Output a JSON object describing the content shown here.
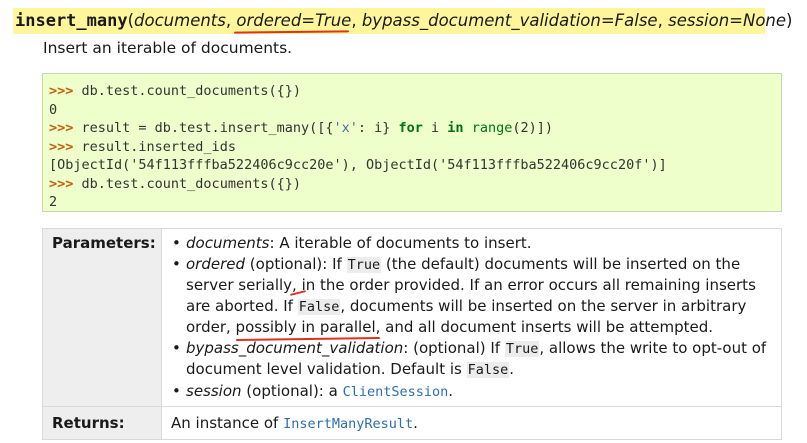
{
  "signature": {
    "function_name": "insert_many",
    "open_paren": "(",
    "close_paren": ")",
    "sep": ", ",
    "params": [
      "documents",
      "ordered=True",
      "bypass_document_validation=False",
      "session=None"
    ]
  },
  "description": "Insert an iterable of documents.",
  "example": {
    "prompt": ">>>",
    "lines": {
      "l1_code": " db.test.count_documents({})",
      "l2_out": "0",
      "l3_pre": " result = db.test.insert_many([{",
      "l3_str": "'x'",
      "l3_mid": ": i} ",
      "l3_kw1": "for",
      "l3_mid2": " i ",
      "l3_kw2": "in",
      "l3_sp": " ",
      "l3_builtin": "range",
      "l3_end": "(2)])",
      "l4_code": " result.inserted_ids",
      "l5_out": "[ObjectId('54f113fffba522406c9cc20e'), ObjectId('54f113fffba522406c9cc20f')]",
      "l6_code": " db.test.count_documents({})",
      "l7_out": "2"
    }
  },
  "fields": {
    "parameters_label": "Parameters:",
    "returns_label": "Returns:",
    "params": {
      "documents": {
        "name": "documents",
        "text": ": A iterable of documents to insert."
      },
      "ordered": {
        "name": "ordered",
        "t1": " (optional): If ",
        "code1": "True",
        "t2": " (the default) documents will be inserted on the server serially, in the order provided. If an error occurs all remaining inserts are aborted. If ",
        "code2": "False",
        "t3": ", documents will be inserted on the server in arbitrary order, ",
        "underlined": "possibly in parallel",
        "t4": ", and all document inserts will be attempted."
      },
      "bypass": {
        "name": "bypass_document_validation",
        "t1": ": (optional) If ",
        "code1": "True",
        "t2": ", allows the write to opt-out of document level validation. Default is ",
        "code2": "False",
        "t3": "."
      },
      "session": {
        "name": "session",
        "t1": " (optional): a ",
        "link": "ClientSession",
        "t2": "."
      }
    },
    "returns": {
      "t1": "An instance of ",
      "link": "InsertManyResult",
      "t2": "."
    }
  },
  "colors": {
    "signature_highlight": "#fff59a",
    "code_background": "#eeffcc",
    "prompt": "#c65d09",
    "string": "#4070a0",
    "keyword": "#007020",
    "link": "#2a6fb0",
    "annotation": "#e0301e"
  }
}
